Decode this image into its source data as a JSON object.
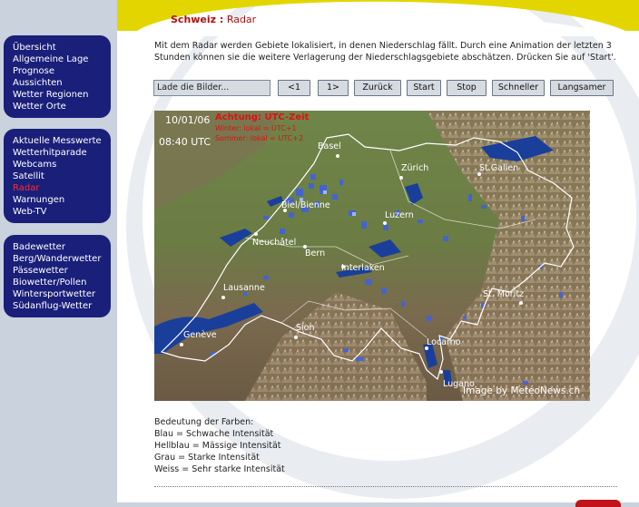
{
  "breadcrumb": {
    "section": "Schweiz :",
    "page": "Radar"
  },
  "sidebar": {
    "groups": [
      {
        "items": [
          {
            "label": "Übersicht",
            "active": false
          },
          {
            "label": "Allgemeine Lage",
            "active": false
          },
          {
            "label": "Prognose",
            "active": false
          },
          {
            "label": "Aussichten",
            "active": false
          },
          {
            "label": "Wetter Regionen",
            "active": false
          },
          {
            "label": "Wetter Orte",
            "active": false
          }
        ]
      },
      {
        "items": [
          {
            "label": "Aktuelle Messwerte",
            "active": false
          },
          {
            "label": "Wetterhitparade",
            "active": false
          },
          {
            "label": "Webcams",
            "active": false
          },
          {
            "label": "Satellit",
            "active": false
          },
          {
            "label": "Radar",
            "active": true
          },
          {
            "label": "Warnungen",
            "active": false
          },
          {
            "label": "Web-TV",
            "active": false
          }
        ]
      },
      {
        "items": [
          {
            "label": "Badewetter",
            "active": false
          },
          {
            "label": "Berg/Wanderwetter",
            "active": false
          },
          {
            "label": "Pässewetter",
            "active": false
          },
          {
            "label": "Biowetter/Pollen",
            "active": false
          },
          {
            "label": "Wintersportwetter",
            "active": false
          },
          {
            "label": "Südanflug-Wetter",
            "active": false
          }
        ]
      }
    ]
  },
  "intro": "Mit dem Radar werden Gebiete lokalisiert, in denen Niederschlag fällt. Durch eine Animation der letzten 3 Stunden können sie die weitere Verlagerung der Niederschlagsgebiete abschätzen. Drücken Sie auf 'Start'.",
  "controls": {
    "status": "Lade die Bilder...",
    "buttons": [
      "<1",
      "1>",
      "Zurück",
      "Start",
      "Stop",
      "Schneller",
      "Langsamer"
    ]
  },
  "radar": {
    "date": "10/01/06",
    "time": "08:40 UTC",
    "warning_title": "Achtung: UTC-Zeit",
    "winter": "Winter: lokal = UTC+1",
    "summer": "Sommer: lokal = UTC+2",
    "credit": "Image by MeteoNews.ch",
    "cities": [
      "Basel",
      "Zürich",
      "St.Gallen",
      "Biel/Bienne",
      "Luzern",
      "Neuchâtel",
      "Bern",
      "Interlaken",
      "Lausanne",
      "St. Moritz",
      "Sion",
      "Genève",
      "Locarno",
      "Lugano"
    ]
  },
  "legend": {
    "title": "Bedeutung der Farben:",
    "items": [
      "Blau = Schwache Intensität",
      "Hellblau = Mässige Intensität",
      "Grau = Starke Intensität",
      "Weiss = Sehr starke Intensität"
    ]
  },
  "colors": {
    "nav_bg": "#1a1f7a",
    "accent_red": "#b01010",
    "arc_yellow": "#e3d600"
  }
}
